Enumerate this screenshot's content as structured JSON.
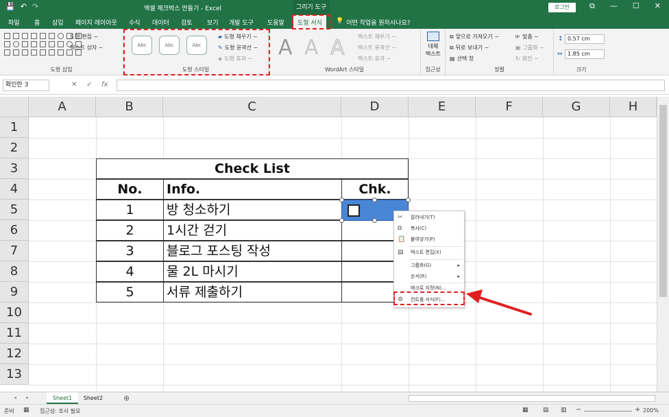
{
  "titlebar": {
    "qat_save": "💾",
    "qat_undo": "↶",
    "qat_redo": "↷",
    "title": "엑셀 체크박스 만들기 - Excel",
    "context_tab": "그리기 도구",
    "login": "로그인",
    "win_restore": "⧉",
    "win_min": "—",
    "win_max": "☐",
    "win_close": "✕"
  },
  "menu": {
    "tabs": [
      "파일",
      "홈",
      "삽입",
      "페이지 레이아웃",
      "수식",
      "데이터",
      "검토",
      "보기",
      "개발 도구",
      "도움말",
      "도형 서식"
    ],
    "tell_me": "어떤 작업을 원하시나요?"
  },
  "ribbon": {
    "insert_shapes": {
      "edit_shape": "도형 편집 ~",
      "text_box": "텍스트 상자 ~",
      "label": "도형 삽입"
    },
    "shape_styles": {
      "sample": "Abc",
      "fill": "도형 채우기 ~",
      "outline": "도형 윤곽선 ~",
      "effects": "도형 효과 ~",
      "label": "도형 스타일"
    },
    "wordart": {
      "letter": "A",
      "text_fill": "텍스트 채우기 ~",
      "text_outline": "텍스트 윤곽선 ~",
      "text_effects": "텍스트 효과 ~",
      "label": "WordArt 스타일"
    },
    "accessibility": {
      "alt_text_1": "대체",
      "alt_text_2": "텍스트",
      "label": "접근성"
    },
    "arrange": {
      "bring_forward": "앞으로 가져오기 ~",
      "send_backward": "뒤로 보내기 ~",
      "selection_pane": "선택 창",
      "align": "맞춤 ~",
      "group": "그룹화 ~",
      "rotate": "회전 ~",
      "label": "정렬"
    },
    "size": {
      "height": "0.57 cm",
      "width": "1.85 cm",
      "label": "크기"
    }
  },
  "formula_bar": {
    "name_box": "확인란 3",
    "cancel": "✕",
    "enter": "✓",
    "fx": "fx",
    "formula": ""
  },
  "grid": {
    "columns": [
      "A",
      "B",
      "C",
      "D",
      "E",
      "F",
      "G",
      "H"
    ],
    "rows": [
      "1",
      "2",
      "3",
      "4",
      "5",
      "6",
      "7",
      "8",
      "9",
      "10",
      "11",
      "12",
      "13"
    ]
  },
  "checklist": {
    "title": "Check List",
    "header_no": "No.",
    "header_info": "Info.",
    "header_chk": "Chk.",
    "items": [
      {
        "no": "1",
        "info": "방 청소하기"
      },
      {
        "no": "2",
        "info": "1시간 걷기"
      },
      {
        "no": "3",
        "info": "블로그 포스팅 작성"
      },
      {
        "no": "4",
        "info": "물 2L 마시기"
      },
      {
        "no": "5",
        "info": "서류 제출하기"
      }
    ]
  },
  "context_menu": {
    "cut": "잘라내기(T)",
    "copy": "복사(C)",
    "paste": "붙여넣기(P)",
    "edit_text": "텍스트 편집(X)",
    "group": "그룹화(G)",
    "order": "순서(R)",
    "assign_macro": "매크로 지정(N)...",
    "format_control": "컨트롤 서식(F)..."
  },
  "sheets": {
    "tabs": [
      "Sheet1",
      "Sheet2"
    ],
    "add": "⊕"
  },
  "status": {
    "ready": "준비",
    "accessibility": "접근성: 조사 필요",
    "zoom": "200%"
  },
  "colors": {
    "excel_green": "#217346",
    "highlight_red": "#e02020",
    "selected_control": "#4a86d6"
  }
}
